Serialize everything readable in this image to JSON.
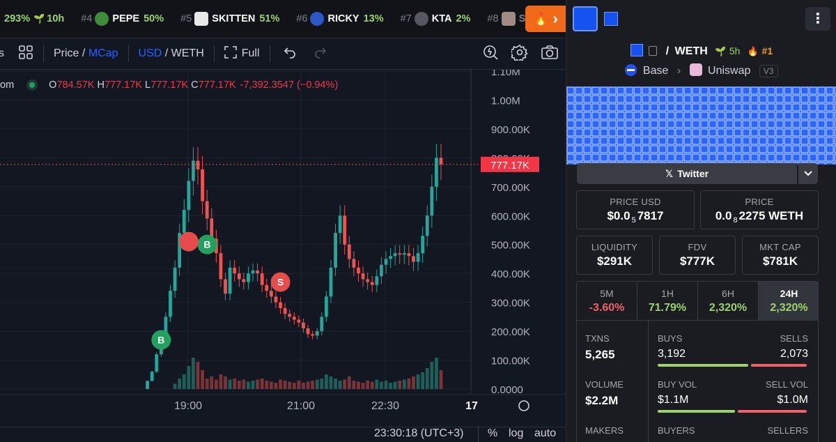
{
  "ticker": [
    {
      "rank": "",
      "name": "",
      "pct": "293%",
      "age": "10h",
      "avatar_color": "#2b2e36"
    },
    {
      "rank": "#4",
      "name": "PEPE",
      "pct": "50%",
      "age": "",
      "avatar_color": "#3f8c3a"
    },
    {
      "rank": "#5",
      "name": "SKITTEN",
      "pct": "51%",
      "age": "",
      "avatar_color": "#e8e8e8"
    },
    {
      "rank": "#6",
      "name": "RICKY",
      "pct": "13%",
      "age": "",
      "avatar_color": "#2b57c8"
    },
    {
      "rank": "#7",
      "name": "KTA",
      "pct": "2%",
      "age": "",
      "avatar_color": "#555860"
    },
    {
      "rank": "#8",
      "name": "S",
      "pct": "",
      "age": "",
      "avatar_color": "#a08a84"
    }
  ],
  "fire_button": {
    "arrow": "›"
  },
  "toolbar": {
    "interval": "s",
    "price": "Price",
    "slash": "/",
    "mcap": "MCap",
    "usd": "USD",
    "weth": "WETH",
    "full": "Full"
  },
  "legend": {
    "prefix": "om",
    "o_label": "O",
    "o": "784.57K",
    "h_label": "H",
    "h": "777.17K",
    "l_label": "L",
    "l": "777.17K",
    "c_label": "C",
    "c": "777.17K",
    "change": "-7,392.3547 (−0.94%)"
  },
  "chart_data": {
    "type": "candlestick",
    "x_ticks": [
      "19:00",
      "21:00",
      "22:30",
      "17"
    ],
    "y_ticks": [
      "1.10M",
      "1.00M",
      "900.00K",
      "800.00K",
      "700.00K",
      "600.00K",
      "500.00K",
      "400.00K",
      "300.00K",
      "200.00K",
      "100.00K",
      "0.0000"
    ],
    "ylim": [
      0,
      1100000
    ],
    "last_price": 777170,
    "last_price_label": "777.17K",
    "price_series": [
      [
        0,
        0
      ],
      [
        1,
        28000
      ],
      [
        2,
        60000
      ],
      [
        3,
        120000
      ],
      [
        4,
        190000
      ],
      [
        5,
        250000
      ],
      [
        6,
        340000
      ],
      [
        7,
        420000
      ],
      [
        8,
        540000
      ],
      [
        9,
        620000
      ],
      [
        10,
        720000
      ],
      [
        11,
        790000
      ],
      [
        12,
        760000
      ],
      [
        13,
        650000
      ],
      [
        14,
        590000
      ],
      [
        15,
        520000
      ],
      [
        16,
        470000
      ],
      [
        17,
        380000
      ],
      [
        18,
        330000
      ],
      [
        19,
        420000
      ],
      [
        20,
        400000
      ],
      [
        21,
        380000
      ],
      [
        22,
        370000
      ],
      [
        23,
        400000
      ],
      [
        24,
        410000
      ],
      [
        25,
        400000
      ],
      [
        26,
        360000
      ],
      [
        27,
        340000
      ],
      [
        28,
        320000
      ],
      [
        29,
        300000
      ],
      [
        30,
        280000
      ],
      [
        31,
        260000
      ],
      [
        32,
        250000
      ],
      [
        33,
        240000
      ],
      [
        34,
        230000
      ],
      [
        35,
        210000
      ],
      [
        36,
        190000
      ],
      [
        37,
        185000
      ],
      [
        38,
        200000
      ],
      [
        39,
        250000
      ],
      [
        40,
        320000
      ],
      [
        41,
        420000
      ],
      [
        42,
        540000
      ],
      [
        43,
        600000
      ],
      [
        44,
        500000
      ],
      [
        45,
        450000
      ],
      [
        46,
        420000
      ],
      [
        47,
        400000
      ],
      [
        48,
        380000
      ],
      [
        49,
        370000
      ],
      [
        50,
        360000
      ],
      [
        51,
        390000
      ],
      [
        52,
        430000
      ],
      [
        53,
        450000
      ],
      [
        54,
        460000
      ],
      [
        55,
        470000
      ],
      [
        56,
        465000
      ],
      [
        57,
        470000
      ],
      [
        58,
        460000
      ],
      [
        59,
        440000
      ],
      [
        60,
        470000
      ],
      [
        61,
        530000
      ],
      [
        62,
        600000
      ],
      [
        63,
        700000
      ],
      [
        64,
        800000
      ],
      [
        65,
        777170
      ]
    ],
    "volume_series": [
      0,
      0,
      0,
      0,
      0,
      0,
      0,
      5,
      10,
      14,
      22,
      30,
      26,
      18,
      10,
      12,
      9,
      14,
      12,
      9,
      10,
      8,
      9,
      7,
      8,
      9,
      10,
      8,
      7,
      6,
      9,
      8,
      7,
      6,
      8,
      6,
      7,
      8,
      9,
      10,
      14,
      12,
      10,
      8,
      9,
      12,
      8,
      7,
      6,
      8,
      7,
      9,
      7,
      8,
      6,
      7,
      8,
      9,
      10,
      12,
      14,
      16,
      20,
      26,
      30,
      18
    ],
    "markers": [
      {
        "label": "B",
        "x": 11,
        "price": 500000,
        "color": "#22a05e"
      },
      {
        "label": "",
        "x": 10,
        "price": 510000,
        "color": "#e74c4c"
      },
      {
        "label": "S",
        "x": 30,
        "price": 370000,
        "color": "#e74c4c"
      },
      {
        "label": "B",
        "x": 4,
        "price": 170000,
        "color": "#22a05e"
      }
    ]
  },
  "status": {
    "time": "23:30:18 (UTC+3)",
    "pct": "%",
    "log": "log",
    "auto": "auto"
  },
  "panel": {
    "pair_slash": "/",
    "pair_quote": "WETH",
    "age": "5h",
    "rank": "#1",
    "chain": "Base",
    "dex": "Uniswap",
    "version": "V3",
    "twitter": "Twitter",
    "price_usd_label": "PRICE USD",
    "price_usd_prefix": "$0.0",
    "price_usd_sub": "5",
    "price_usd_rest": "7817",
    "price_label": "PRICE",
    "price_prefix": "0.0",
    "price_sub": "8",
    "price_rest": "2275 WETH",
    "liquidity_label": "LIQUIDITY",
    "liquidity": "$291K",
    "fdv_label": "FDV",
    "fdv": "$777K",
    "mcap_label": "MKT CAP",
    "mcap": "$781K",
    "timeframes": [
      {
        "t": "5M",
        "p": "-3.60%",
        "color": "#f0616a"
      },
      {
        "t": "1H",
        "p": "71.79%",
        "color": "#9bd36c"
      },
      {
        "t": "6H",
        "p": "2,320%",
        "color": "#9bd36c"
      },
      {
        "t": "24H",
        "p": "2,320%",
        "color": "#9bd36c"
      }
    ],
    "txns_label": "TXNS",
    "txns": "5,265",
    "buys_label": "BUYS",
    "buys": "3,192",
    "buys_share": 0.606,
    "sells_label": "SELLS",
    "sells": "2,073",
    "volume_label": "VOLUME",
    "volume": "$2.2M",
    "buy_vol_label": "BUY VOL",
    "buy_vol": "$1.1M",
    "buy_vol_share": 0.52,
    "sell_vol_label": "SELL VOL",
    "sell_vol": "$1.0M",
    "makers_label": "MAKERS",
    "buyers_label": "BUYERS",
    "sellers_label": "SELLERS",
    "colors": {
      "green": "#9bd36c",
      "red": "#f0616a",
      "blue": "#2962ff"
    }
  }
}
